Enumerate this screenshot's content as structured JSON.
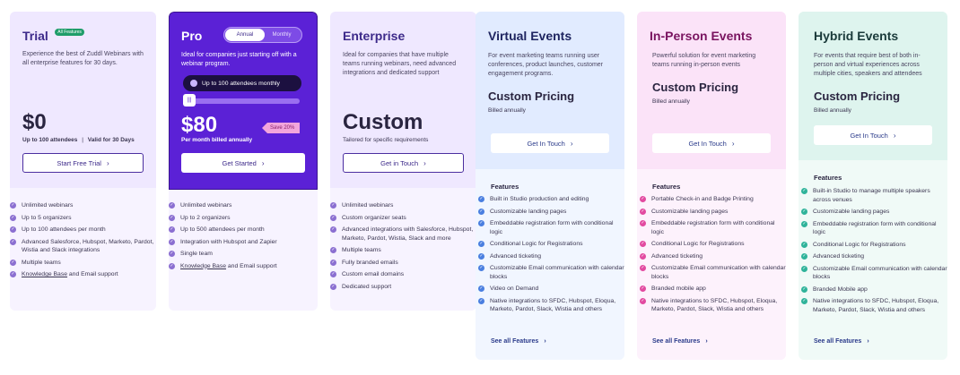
{
  "trial": {
    "title": "Trial",
    "badge": "All Features",
    "desc": "Experience the best of Zuddl Webinars with all enterprise features for 30 days.",
    "price": "$0",
    "sub_left": "Up to 100 attendees",
    "sub_sep": "|",
    "sub_right": "Valid for 30 Days",
    "button": "Start Free Trial",
    "features": [
      "Unlimited webinars",
      "Up to 5 organizers",
      "Up to 100 attendees per month",
      "Advanced Salesforce, Hubspot, Marketo, Pardot, Wistia and Slack integrations",
      "Multiple teams"
    ],
    "last_link": "Knowledge Base",
    "last_rest": " and Email support"
  },
  "pro": {
    "title": "Pro",
    "toggle_annual": "Annual",
    "toggle_monthly": "Monthly",
    "desc": "Ideal for companies just starting off with a webinar program.",
    "attendees_select": "Up to 100 attendees monthly",
    "slider_level": 0.0,
    "price": "$80",
    "price_sub": "Per month billed annually",
    "save_badge": "Save 20%",
    "button": "Get Started",
    "features": [
      "Unlimited webinars",
      "Up to 2 organizers",
      "Up to 500 attendees per month",
      "Integration with Hubspot and Zapier",
      "Single team"
    ],
    "last_link": "Knowledge Base",
    "last_rest": " and Email support"
  },
  "enterprise": {
    "title": "Enterprise",
    "desc": "Ideal for companies that have multiple teams running webinars, need advanced integrations and dedicated support",
    "price": "Custom",
    "price_sub": "Tailored for specific requirements",
    "button": "Get in Touch",
    "features": [
      "Unlimited webinars",
      "Custom organizer seats",
      "Advanced integrations with Salesforce, Hubspot, Marketo, Pardot, Wistia, Slack and more",
      "Multiple teams",
      "Fully branded emails",
      "Custom email domains",
      "Dedicated support"
    ]
  },
  "virtual": {
    "title": "Virtual Events",
    "desc": "For event marketing teams running user conferences, product launches, customer engagement programs.",
    "price": "Custom Pricing",
    "billed": "Billed annually",
    "button": "Get In Touch",
    "features_title": "Features",
    "features": [
      "Built in Studio production and editing",
      "Customizable landing pages",
      "Embeddable registration form with conditional logic",
      "Conditional Logic for Registrations",
      "Advanced ticketing",
      "Customizable Email communication with calendar blocks",
      "Video on Demand",
      "Native integrations to SFDC, Hubspot, Eloqua, Marketo, Pardot, Slack, Wistia and others"
    ],
    "see_all": "See all Features"
  },
  "inperson": {
    "title": "In-Person Events",
    "desc": "Powerful solution for event marketing teams running in-person events",
    "price": "Custom Pricing",
    "billed": "Billed annually",
    "button": "Get In Touch",
    "features_title": "Features",
    "features": [
      "Portable Check-in and Badge Printing",
      "Customizable landing pages",
      "Embeddable registration form with conditional logic",
      "Conditional Logic for Registrations",
      "Advanced ticketing",
      "Customizable Email communication with calendar blocks",
      "Branded mobile app",
      "Native integrations to SFDC, Hubspot, Eloqua, Marketo, Pardot, Slack, Wistia and others"
    ],
    "see_all": "See all Features"
  },
  "hybrid": {
    "title": "Hybrid Events",
    "desc": "For events that require best of both in-person and virtual experiences across multiple cities, speakers and attendees",
    "price": "Custom Pricing",
    "billed": "Billed annually",
    "button": "Get In Touch",
    "features_title": "Features",
    "features": [
      "Built-in Studio to manage multiple speakers across venues",
      "Customizable landing pages",
      "Embeddable registration form with conditional logic",
      "Conditional Logic for Registrations",
      "Advanced ticketing",
      "Customizable Email communication with calendar blocks",
      "Branded Mobile app",
      "Native integrations to SFDC, Hubspot, Eloqua, Marketo, Pardot, Slack, Wistia and others"
    ],
    "see_all": "See all Features"
  },
  "icons": {
    "check": "check-circle-icon",
    "chevron": "chevron-right-icon",
    "user": "user-icon"
  },
  "colors": {
    "purple": "#5b21d6",
    "lavender": "#f1ebff",
    "virtual_bg": "#e6efff",
    "inperson_bg": "#fde8fb",
    "hybrid_bg": "#e3f5f1",
    "pink": "#e24aa0",
    "blue": "#4a7fe0",
    "teal": "#2fb39a"
  }
}
